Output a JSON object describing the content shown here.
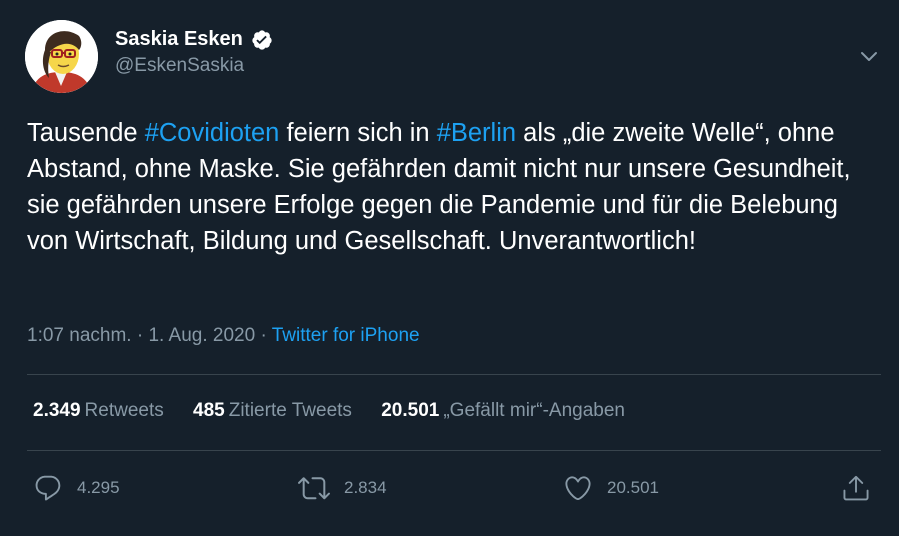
{
  "author": {
    "display_name": "Saskia Esken",
    "handle": "@EskenSaskia",
    "verified": true
  },
  "tweet": {
    "segments": [
      {
        "text": "Tausende ",
        "type": "text"
      },
      {
        "text": "#Covidioten",
        "type": "hashtag"
      },
      {
        "text": " feiern sich in ",
        "type": "text"
      },
      {
        "text": "#Berlin",
        "type": "hashtag"
      },
      {
        "text": " als „die zweite Welle“, ohne Abstand, ohne Maske. Sie gefährden damit nicht nur unsere Gesundheit, sie gefährden unsere Erfolge gegen die Pandemie und für die Belebung von Wirtschaft, Bildung und Gesellschaft. Unverantwortlich!",
        "type": "text"
      }
    ],
    "time": "1:07 nachm.",
    "date": "1. Aug. 2020",
    "separator": "·",
    "source": "Twitter for iPhone"
  },
  "stats": {
    "retweets": {
      "value": "2.349",
      "label": "Retweets"
    },
    "quotes": {
      "value": "485",
      "label": "Zitierte Tweets"
    },
    "likes": {
      "value": "20.501",
      "label": "„Gefällt mir“-Angaben"
    }
  },
  "actions": {
    "reply": {
      "icon": "reply-icon",
      "count": "4.295"
    },
    "retweet": {
      "icon": "retweet-icon",
      "count": "2.834"
    },
    "like": {
      "icon": "heart-icon",
      "count": "20.501"
    },
    "share": {
      "icon": "share-icon"
    }
  },
  "colors": {
    "background": "#15202b",
    "text": "#ffffff",
    "secondary": "#8899a6",
    "accent": "#1da1f2",
    "divider": "#38444d"
  }
}
